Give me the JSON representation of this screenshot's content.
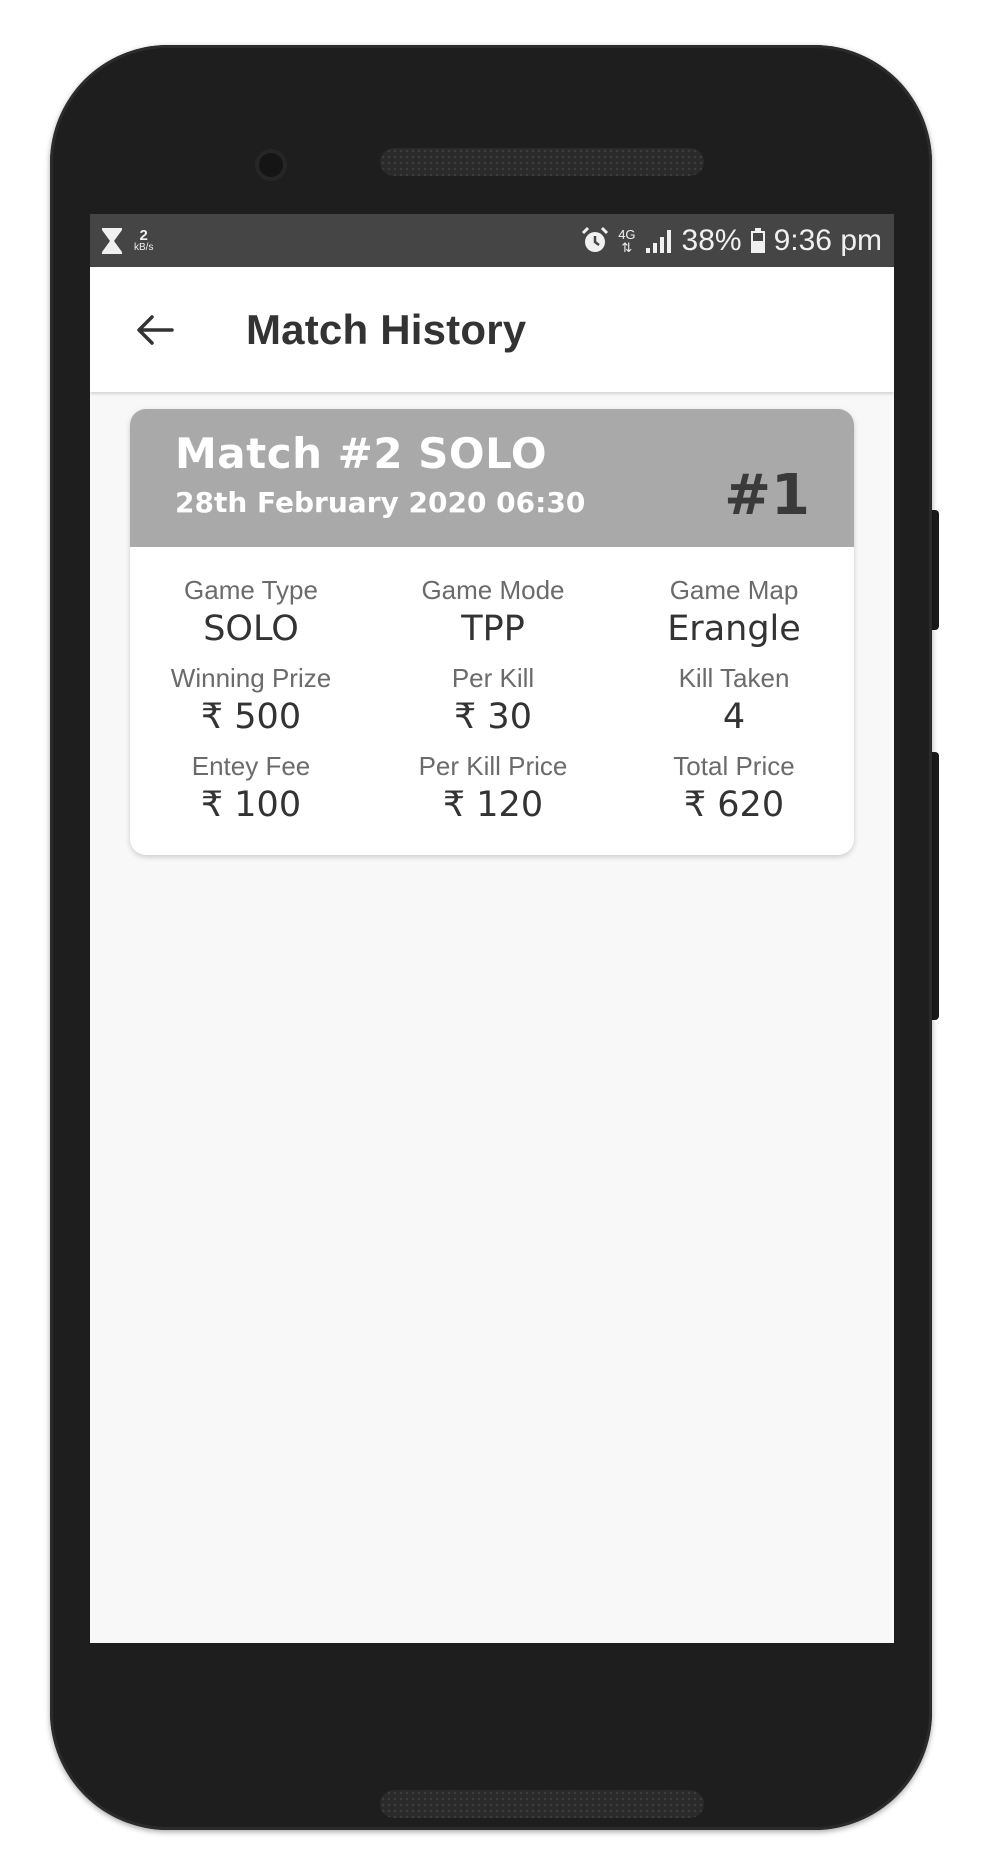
{
  "status_bar": {
    "net_speed_value": "2",
    "net_speed_unit": "kB/s",
    "network_type": "4G",
    "battery_percent": "38%",
    "time": "9:36 pm",
    "icons": [
      "hourglass-icon",
      "alarm-icon",
      "signal-icon",
      "battery-icon"
    ]
  },
  "app_bar": {
    "title": "Match History",
    "back_icon": "arrow-left"
  },
  "match_card": {
    "title": "Match #2 SOLO",
    "date": "28th February 2020 06:30",
    "rank": "#1",
    "header_color": "#a9a9a9",
    "stats": [
      {
        "label": "Game Type",
        "value": "SOLO"
      },
      {
        "label": "Game Mode",
        "value": "TPP"
      },
      {
        "label": "Game Map",
        "value": "Erangle"
      },
      {
        "label": "Winning Prize",
        "value": "₹ 500"
      },
      {
        "label": "Per Kill",
        "value": "₹ 30"
      },
      {
        "label": "Kill Taken",
        "value": "4"
      },
      {
        "label": "Entey Fee",
        "value": "₹ 100"
      },
      {
        "label": "Per Kill Price",
        "value": "₹ 120"
      },
      {
        "label": "Total Price",
        "value": "₹ 620"
      }
    ]
  }
}
